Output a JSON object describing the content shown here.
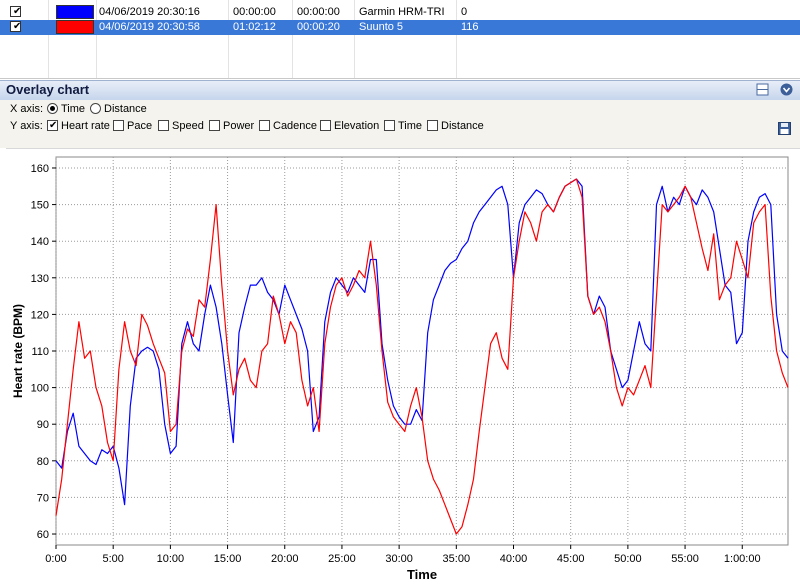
{
  "activities": {
    "rows": [
      {
        "checked": true,
        "color": "#0000ff",
        "start": "04/06/2019 20:30:16",
        "duration": "00:00:00",
        "offset": "00:00:00",
        "device": "Garmin HRM-TRI",
        "value": "0",
        "selected": false
      },
      {
        "checked": true,
        "color": "#ff0000",
        "start": "04/06/2019 20:30:58",
        "duration": "01:02:12",
        "offset": "00:00:20",
        "device": "Suunto 5",
        "value": "116",
        "selected": true
      }
    ]
  },
  "panel": {
    "title": "Overlay chart",
    "layout_icon": "layout-icon",
    "collapse_icon": "chevron-down-circle-icon",
    "save_icon": "save-icon"
  },
  "options": {
    "xaxis_label": "X axis:",
    "xaxis": [
      {
        "label": "Time",
        "selected": true
      },
      {
        "label": "Distance",
        "selected": false
      }
    ],
    "yaxis_label": "Y axis:",
    "yaxis": [
      {
        "label": "Heart rate",
        "checked": true
      },
      {
        "label": "Pace",
        "checked": false
      },
      {
        "label": "Speed",
        "checked": false
      },
      {
        "label": "Power",
        "checked": false
      },
      {
        "label": "Cadence",
        "checked": false
      },
      {
        "label": "Elevation",
        "checked": false
      },
      {
        "label": "Time",
        "checked": false
      },
      {
        "label": "Distance",
        "checked": false
      }
    ]
  },
  "chart_data": {
    "type": "line",
    "xlabel": "Time",
    "ylabel": "Heart rate (BPM)",
    "x_unit": "minutes",
    "xlim": [
      0,
      64
    ],
    "ylim": [
      57,
      163
    ],
    "xticks": [
      "0:00",
      "5:00",
      "10:00",
      "15:00",
      "20:00",
      "25:00",
      "30:00",
      "35:00",
      "40:00",
      "45:00",
      "50:00",
      "55:00",
      "1:00:00"
    ],
    "xtick_values": [
      0,
      5,
      10,
      15,
      20,
      25,
      30,
      35,
      40,
      45,
      50,
      55,
      60
    ],
    "yticks": [
      60,
      70,
      80,
      90,
      100,
      110,
      120,
      130,
      140,
      150,
      160
    ],
    "grid": true,
    "series": [
      {
        "color": "#0000ff",
        "x": [
          0,
          0.5,
          1,
          1.5,
          2,
          2.5,
          3,
          3.5,
          4,
          4.5,
          5,
          5.5,
          6,
          6.5,
          7,
          7.5,
          8,
          8.5,
          9,
          9.5,
          10,
          10.5,
          11,
          11.5,
          12,
          12.5,
          13,
          13.5,
          14,
          14.5,
          15,
          15.5,
          16,
          16.5,
          17,
          17.5,
          18,
          18.5,
          19,
          19.5,
          20,
          20.5,
          21,
          21.5,
          22,
          22.5,
          23,
          23.5,
          24,
          24.5,
          25,
          25.5,
          26,
          26.5,
          27,
          27.5,
          28,
          28.5,
          29,
          29.5,
          30,
          30.5,
          31,
          31.5,
          32,
          32.5,
          33,
          33.5,
          34,
          34.5,
          35,
          35.5,
          36,
          36.5,
          37,
          37.5,
          38,
          38.5,
          39,
          39.5,
          40,
          40.5,
          41,
          41.5,
          42,
          42.5,
          43,
          43.5,
          44,
          44.5,
          45,
          45.5,
          46,
          46.5,
          47,
          47.5,
          48,
          48.5,
          49,
          49.5,
          50,
          50.5,
          51,
          51.5,
          52,
          52.5,
          53,
          53.5,
          54,
          54.5,
          55,
          55.5,
          56,
          56.5,
          57,
          57.5,
          58,
          58.5,
          59,
          59.5,
          60,
          60.5,
          61,
          61.5,
          62,
          62.5,
          63,
          63.5,
          64
        ],
        "y": [
          80,
          78,
          88,
          93,
          84,
          82,
          80,
          79,
          83,
          82,
          84,
          78,
          68,
          95,
          108,
          110,
          111,
          110,
          105,
          90,
          82,
          84,
          112,
          118,
          112,
          110,
          120,
          128,
          122,
          112,
          98,
          85,
          115,
          122,
          128,
          128,
          130,
          126,
          124,
          120,
          128,
          124,
          120,
          116,
          110,
          88,
          92,
          118,
          126,
          130,
          128,
          126,
          130,
          128,
          126,
          135,
          135,
          112,
          102,
          95,
          92,
          90,
          90,
          94,
          91,
          115,
          124,
          128,
          132,
          134,
          135,
          138,
          140,
          145,
          148,
          150,
          152,
          154,
          155,
          150,
          130,
          145,
          150,
          152,
          154,
          153,
          150,
          148,
          152,
          155,
          156,
          157,
          155,
          125,
          120,
          125,
          122,
          110,
          105,
          100,
          102,
          110,
          118,
          112,
          110,
          150,
          155,
          148,
          152,
          150,
          155,
          152,
          150,
          154,
          152,
          148,
          138,
          128,
          126,
          112,
          115,
          140,
          148,
          152,
          153,
          150,
          120,
          110,
          108
        ],
        "name": ""
      },
      {
        "color": "#ff0000",
        "x": [
          0,
          0.5,
          1,
          1.5,
          2,
          2.5,
          3,
          3.5,
          4,
          4.5,
          5,
          5.5,
          6,
          6.5,
          7,
          7.5,
          8,
          8.5,
          9,
          9.5,
          10,
          10.5,
          11,
          11.5,
          12,
          12.5,
          13,
          13.5,
          14,
          14.5,
          15,
          15.5,
          16,
          16.5,
          17,
          17.5,
          18,
          18.5,
          19,
          19.5,
          20,
          20.5,
          21,
          21.5,
          22,
          22.5,
          23,
          23.5,
          24,
          24.5,
          25,
          25.5,
          26,
          26.5,
          27,
          27.5,
          28,
          28.5,
          29,
          29.5,
          30,
          30.5,
          31,
          31.5,
          32,
          32.5,
          33,
          33.5,
          34,
          34.5,
          35,
          35.5,
          36,
          36.5,
          37,
          37.5,
          38,
          38.5,
          39,
          39.5,
          40,
          40.5,
          41,
          41.5,
          42,
          42.5,
          43,
          43.5,
          44,
          44.5,
          45,
          45.5,
          46,
          46.5,
          47,
          47.5,
          48,
          48.5,
          49,
          49.5,
          50,
          50.5,
          51,
          51.5,
          52,
          52.5,
          53,
          53.5,
          54,
          54.5,
          55,
          55.5,
          56,
          56.5,
          57,
          57.5,
          58,
          58.5,
          59,
          59.5,
          60,
          60.5,
          61,
          61.5,
          62,
          62.5,
          63,
          63.5,
          64
        ],
        "y": [
          65,
          75,
          90,
          105,
          118,
          108,
          110,
          100,
          95,
          85,
          80,
          105,
          118,
          110,
          106,
          120,
          117,
          112,
          108,
          104,
          88,
          90,
          110,
          116,
          114,
          124,
          122,
          135,
          150,
          128,
          110,
          98,
          105,
          108,
          102,
          100,
          110,
          112,
          125,
          120,
          112,
          118,
          115,
          102,
          95,
          100,
          88,
          112,
          122,
          128,
          130,
          125,
          128,
          132,
          130,
          140,
          128,
          110,
          96,
          92,
          90,
          88,
          95,
          100,
          92,
          80,
          75,
          72,
          68,
          64,
          60,
          62,
          68,
          75,
          88,
          100,
          112,
          115,
          108,
          105,
          130,
          140,
          148,
          145,
          140,
          148,
          150,
          148,
          152,
          155,
          156,
          157,
          152,
          125,
          120,
          122,
          118,
          110,
          100,
          95,
          100,
          98,
          102,
          106,
          100,
          125,
          150,
          148,
          150,
          152,
          155,
          152,
          145,
          138,
          132,
          142,
          124,
          128,
          130,
          140,
          135,
          130,
          145,
          148,
          150,
          125,
          110,
          104,
          100
        ]
      }
    ]
  }
}
